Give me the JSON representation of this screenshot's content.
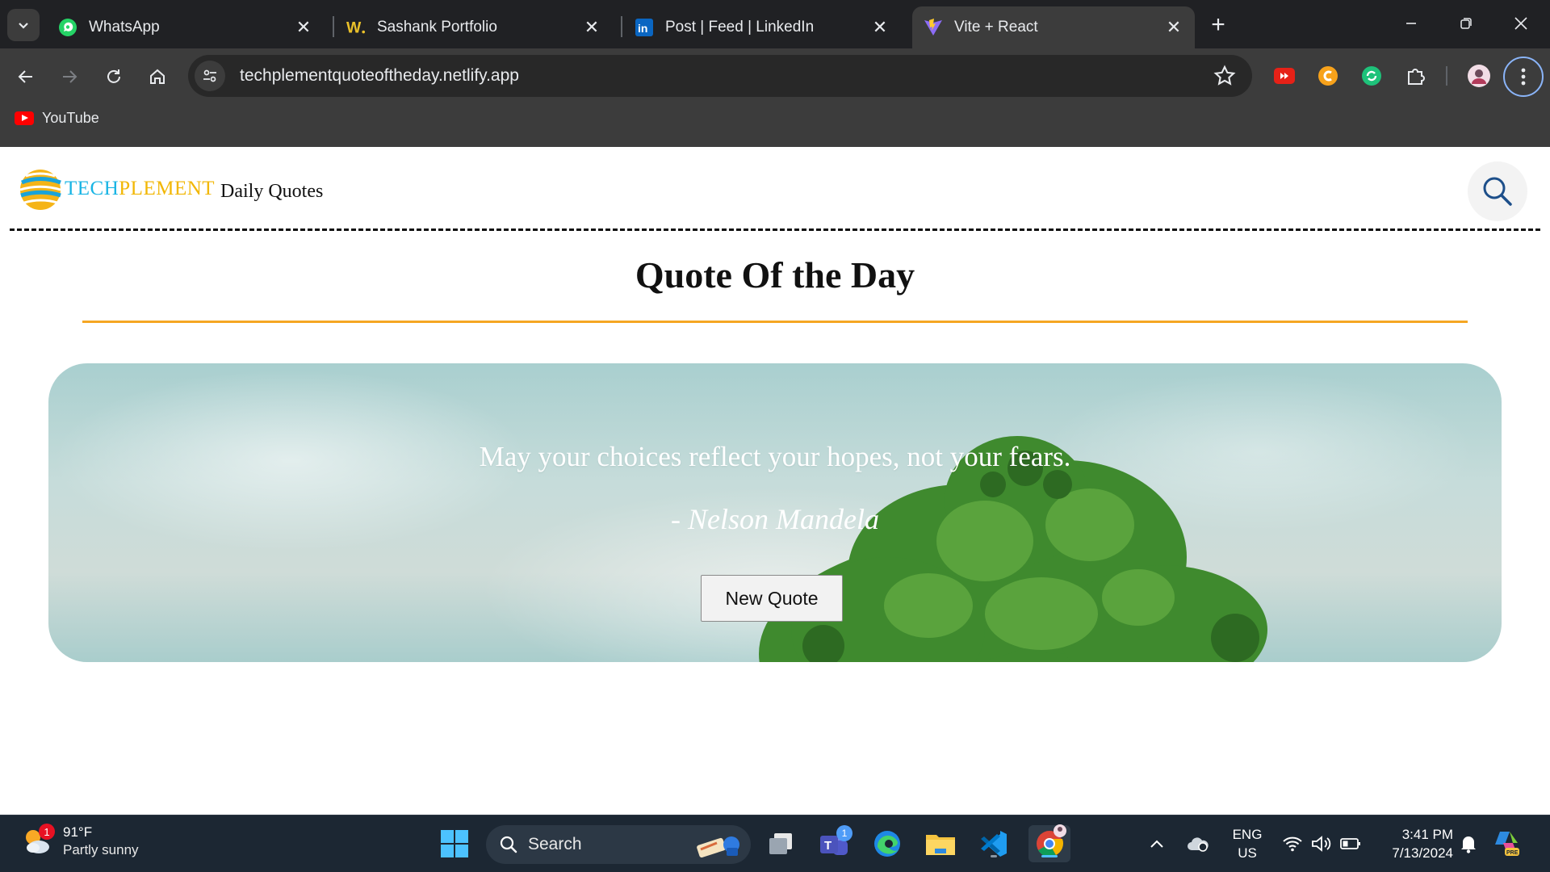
{
  "browser": {
    "tabs": [
      {
        "title": "WhatsApp",
        "icon": "whatsapp-icon",
        "active": false
      },
      {
        "title": "Sashank Portfolio",
        "icon": "portfolio-w-icon",
        "active": false
      },
      {
        "title": "Post | Feed | LinkedIn",
        "icon": "linkedin-icon",
        "active": false
      },
      {
        "title": "Vite + React",
        "icon": "vite-icon",
        "active": true
      }
    ],
    "url": "techplementquoteoftheday.netlify.app",
    "bookmarks": [
      {
        "label": "YouTube",
        "icon": "youtube-icon"
      }
    ],
    "colors": {
      "frame": "#202124",
      "toolbar": "#3c3c3c",
      "omnibox": "#282828",
      "focus_ring": "#8ab4f8"
    }
  },
  "page": {
    "brand_part1": "TECH",
    "brand_part2": "PLEMENT",
    "nav_title": "Daily Quotes",
    "heading": "Quote Of the Day",
    "quote": "May your choices reflect your hopes, not your fears.",
    "author": "- Nelson Mandela",
    "new_quote_label": "New Quote",
    "colors": {
      "brand_blue": "#18b4e4",
      "brand_yellow": "#f2b705",
      "rule_orange": "#f5a623"
    }
  },
  "taskbar": {
    "weather_temp": "91°F",
    "weather_desc": "Partly sunny",
    "weather_badge": "1",
    "search_label": "Search",
    "teams_badge": "1",
    "lang_top": "ENG",
    "lang_bottom": "US",
    "time": "3:41 PM",
    "date": "7/13/2024"
  }
}
